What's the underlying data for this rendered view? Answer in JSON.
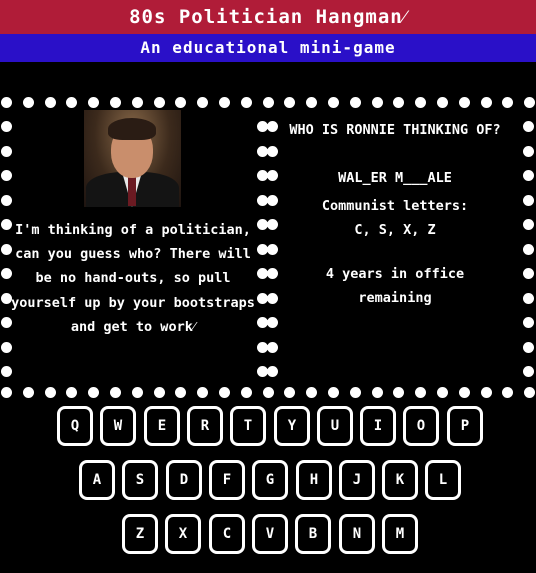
{
  "header": {
    "title": "80s Politician Hangman⁄",
    "subtitle": "An educational mini-game"
  },
  "left_panel": {
    "portrait_alt": "politician-portrait",
    "message": "I'm thinking of a politician, can you guess who? There will be no hand-outs, so pull yourself up by your bootstraps and get to work⁄"
  },
  "right_panel": {
    "question": "WHO IS RONNIE THINKING OF?",
    "puzzle": "WAL_ER M___ALE",
    "wrong_label": "Communist letters:",
    "wrong_letters": "C, S, X, Z",
    "remaining": "4 years in office remaining"
  },
  "keyboard": {
    "rows": [
      [
        "Q",
        "W",
        "E",
        "R",
        "T",
        "Y",
        "U",
        "I",
        "O",
        "P"
      ],
      [
        "A",
        "S",
        "D",
        "F",
        "G",
        "H",
        "J",
        "K",
        "L"
      ],
      [
        "Z",
        "X",
        "C",
        "V",
        "B",
        "N",
        "M"
      ]
    ]
  },
  "colors": {
    "title_bar": "#b01c38",
    "subtitle_bar": "#2a10c8",
    "background": "#000000",
    "text": "#ffffff"
  }
}
